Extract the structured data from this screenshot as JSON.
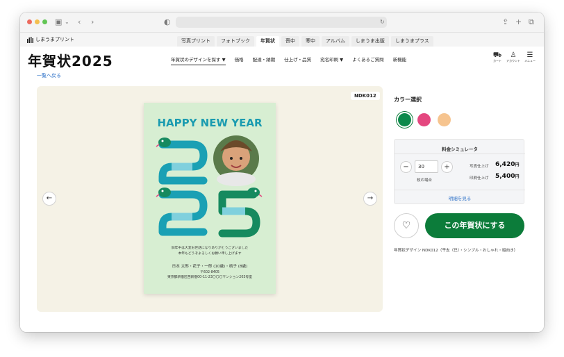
{
  "browser": {
    "url": ""
  },
  "site": {
    "logo_text": "しまうまプリント",
    "top_tabs": [
      "写真プリント",
      "フォトブック",
      "年賀状",
      "喪中",
      "寒中",
      "アルバム",
      "しまうま出版",
      "しまうまプラス"
    ],
    "active_tab": "年賀状",
    "brand_title": "年賀状2025",
    "main_nav": [
      "年賀状のデザインを探す ▼",
      "価格",
      "配達・納期",
      "仕上げ・品質",
      "宛名印刷 ▼",
      "よくあるご質問",
      "新機能"
    ],
    "header_icons": [
      {
        "icon": "cart-icon",
        "label": "カート"
      },
      {
        "icon": "account-icon",
        "label": "アカウント"
      },
      {
        "icon": "menu-icon",
        "label": "メニュー"
      }
    ],
    "back_link": "一覧へ戻る"
  },
  "preview": {
    "design_code": "NDK012",
    "card": {
      "headline": "HAPPY NEW YEAR",
      "greeting_line1": "旧年中は大変お世話になりありがとうございました",
      "greeting_line2": "本年もどうぞよろしくお願い申し上げます",
      "names": "日本 太郎・花子・一郎 (10歳)・桃子 (8歳)",
      "postal": "〒602-8405",
      "address": "東京都新宿区西新宿00-11-23〇〇〇マンション203号室"
    }
  },
  "panel": {
    "color_label": "カラー選択",
    "colors": [
      "#0c8a4b",
      "#e4477f",
      "#f6c48f"
    ],
    "selected_color": 0,
    "simulator": {
      "title": "料金シミュレータ",
      "quantity": "30",
      "unit": "枚の場合",
      "photo_label": "写真仕上げ",
      "photo_price": "6,420",
      "print_label": "印刷仕上げ",
      "print_price": "5,400",
      "currency": "円",
      "details_link": "明細を見る"
    },
    "cta_label": "この年賀状にする",
    "description": "年賀状デザイン NDK012（干支（巳）・シンプル・おしゃれ・縦向き）"
  }
}
